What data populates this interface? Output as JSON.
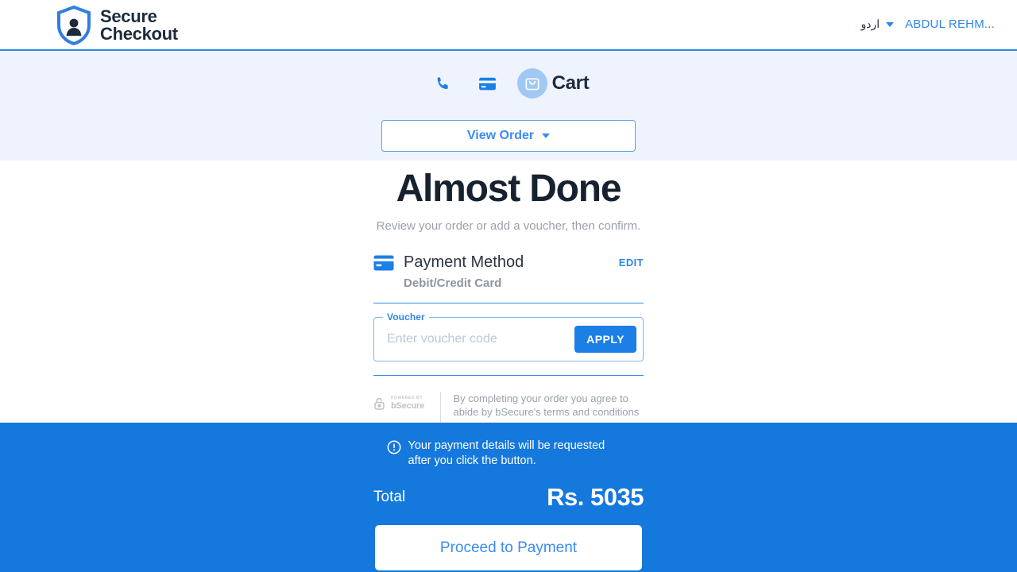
{
  "header": {
    "brand_line1": "Secure",
    "brand_line2": "Checkout",
    "logo_icon": "shield-lock-icon",
    "language": "اردو",
    "language_caret_icon": "chevron-down-icon",
    "user_name": "ABDUL REHM...",
    "accent_color": "#2f86e8"
  },
  "steps": {
    "items": [
      {
        "icon": "phone-icon",
        "label": "",
        "active": false
      },
      {
        "icon": "credit-card-icon",
        "label": "",
        "active": false
      },
      {
        "icon": "shopping-bag-icon",
        "label": "Cart",
        "active": true
      }
    ],
    "view_order_label": "View Order",
    "view_order_caret_icon": "chevron-down-icon",
    "background_color": "#eef3fd"
  },
  "main": {
    "title": "Almost Done",
    "subtitle": "Review your order or add a voucher, then confirm.",
    "payment_method": {
      "icon": "credit-card-icon",
      "title": "Payment Method",
      "edit_label": "EDIT",
      "value": "Debit/Credit Card"
    },
    "voucher": {
      "legend": "Voucher",
      "placeholder": "Enter voucher code",
      "value": "",
      "apply_label": "APPLY"
    },
    "bsecure": {
      "powered_by": "POWERED BY",
      "name": "bSecure",
      "logo_icon": "bsecure-lock-icon",
      "notice": "By completing your order you agree to abide by bSecure's terms and conditions"
    }
  },
  "footer": {
    "notice_icon": "exclamation-circle-icon",
    "notice": "Your payment details will be requested after you click the button.",
    "total_label": "Total",
    "total_value": "Rs. 5035",
    "proceed_label": "Proceed to Payment",
    "background_color": "#1578dc"
  }
}
